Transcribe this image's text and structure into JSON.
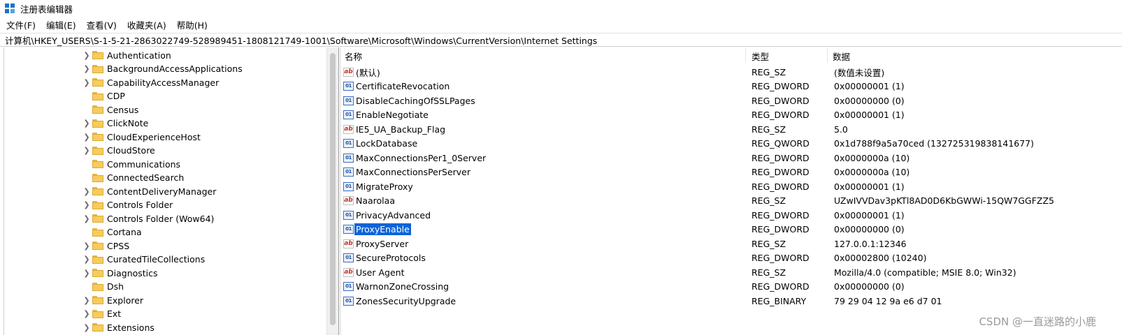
{
  "window": {
    "title": "注册表编辑器"
  },
  "menu": [
    "文件(F)",
    "编辑(E)",
    "查看(V)",
    "收藏夹(A)",
    "帮助(H)"
  ],
  "address": "计算机\\HKEY_USERS\\S-1-5-21-2863022749-528989451-1808121749-1001\\Software\\Microsoft\\Windows\\CurrentVersion\\Internet Settings",
  "tree": [
    {
      "label": "Authentication",
      "expandable": true
    },
    {
      "label": "BackgroundAccessApplications",
      "expandable": true
    },
    {
      "label": "CapabilityAccessManager",
      "expandable": true
    },
    {
      "label": "CDP",
      "expandable": false
    },
    {
      "label": "Census",
      "expandable": false
    },
    {
      "label": "ClickNote",
      "expandable": true
    },
    {
      "label": "CloudExperienceHost",
      "expandable": true
    },
    {
      "label": "CloudStore",
      "expandable": true
    },
    {
      "label": "Communications",
      "expandable": false
    },
    {
      "label": "ConnectedSearch",
      "expandable": false
    },
    {
      "label": "ContentDeliveryManager",
      "expandable": true
    },
    {
      "label": "Controls Folder",
      "expandable": true
    },
    {
      "label": "Controls Folder (Wow64)",
      "expandable": true
    },
    {
      "label": "Cortana",
      "expandable": false
    },
    {
      "label": "CPSS",
      "expandable": true
    },
    {
      "label": "CuratedTileCollections",
      "expandable": true
    },
    {
      "label": "Diagnostics",
      "expandable": true
    },
    {
      "label": "Dsh",
      "expandable": false
    },
    {
      "label": "Explorer",
      "expandable": true
    },
    {
      "label": "Ext",
      "expandable": true
    },
    {
      "label": "Extensions",
      "expandable": true
    }
  ],
  "columns": {
    "name": "名称",
    "type": "类型",
    "data": "数据"
  },
  "values": [
    {
      "icon": "string-value-icon",
      "name": "(默认)",
      "type": "REG_SZ",
      "data": "(数值未设置)"
    },
    {
      "icon": "binary-value-icon",
      "name": "CertificateRevocation",
      "type": "REG_DWORD",
      "data": "0x00000001 (1)"
    },
    {
      "icon": "binary-value-icon",
      "name": "DisableCachingOfSSLPages",
      "type": "REG_DWORD",
      "data": "0x00000000 (0)"
    },
    {
      "icon": "binary-value-icon",
      "name": "EnableNegotiate",
      "type": "REG_DWORD",
      "data": "0x00000001 (1)"
    },
    {
      "icon": "string-value-icon",
      "name": "IE5_UA_Backup_Flag",
      "type": "REG_SZ",
      "data": "5.0"
    },
    {
      "icon": "binary-value-icon",
      "name": "LockDatabase",
      "type": "REG_QWORD",
      "data": "0x1d788f9a5a70ced (132725319838141677)"
    },
    {
      "icon": "binary-value-icon",
      "name": "MaxConnectionsPer1_0Server",
      "type": "REG_DWORD",
      "data": "0x0000000a (10)"
    },
    {
      "icon": "binary-value-icon",
      "name": "MaxConnectionsPerServer",
      "type": "REG_DWORD",
      "data": "0x0000000a (10)"
    },
    {
      "icon": "binary-value-icon",
      "name": "MigrateProxy",
      "type": "REG_DWORD",
      "data": "0x00000001 (1)"
    },
    {
      "icon": "string-value-icon",
      "name": "Naarolaa",
      "type": "REG_SZ",
      "data": "UZwIVVDav3pKTl8AD0D6KbGWWi-15QW7GGFZZ5"
    },
    {
      "icon": "binary-value-icon",
      "name": "PrivacyAdvanced",
      "type": "REG_DWORD",
      "data": "0x00000001 (1)"
    },
    {
      "icon": "binary-value-icon",
      "name": "ProxyEnable",
      "type": "REG_DWORD",
      "data": "0x00000000 (0)",
      "selected": true
    },
    {
      "icon": "string-value-icon",
      "name": "ProxyServer",
      "type": "REG_SZ",
      "data": "127.0.0.1:12346"
    },
    {
      "icon": "binary-value-icon",
      "name": "SecureProtocols",
      "type": "REG_DWORD",
      "data": "0x00002800 (10240)"
    },
    {
      "icon": "string-value-icon",
      "name": "User Agent",
      "type": "REG_SZ",
      "data": "Mozilla/4.0 (compatible; MSIE 8.0; Win32)"
    },
    {
      "icon": "binary-value-icon",
      "name": "WarnonZoneCrossing",
      "type": "REG_DWORD",
      "data": "0x00000000 (0)"
    },
    {
      "icon": "binary-value-icon",
      "name": "ZonesSecurityUpgrade",
      "type": "REG_BINARY",
      "data": "79 29 04 12 9a e6 d7 01"
    }
  ],
  "watermark": "CSDN @一直迷路的小鹿",
  "colors": {
    "selection": "#0a64d8",
    "folder": "#f6cc5a",
    "string_icon": "#c0392b",
    "binary_icon": "#1f4e9c"
  }
}
